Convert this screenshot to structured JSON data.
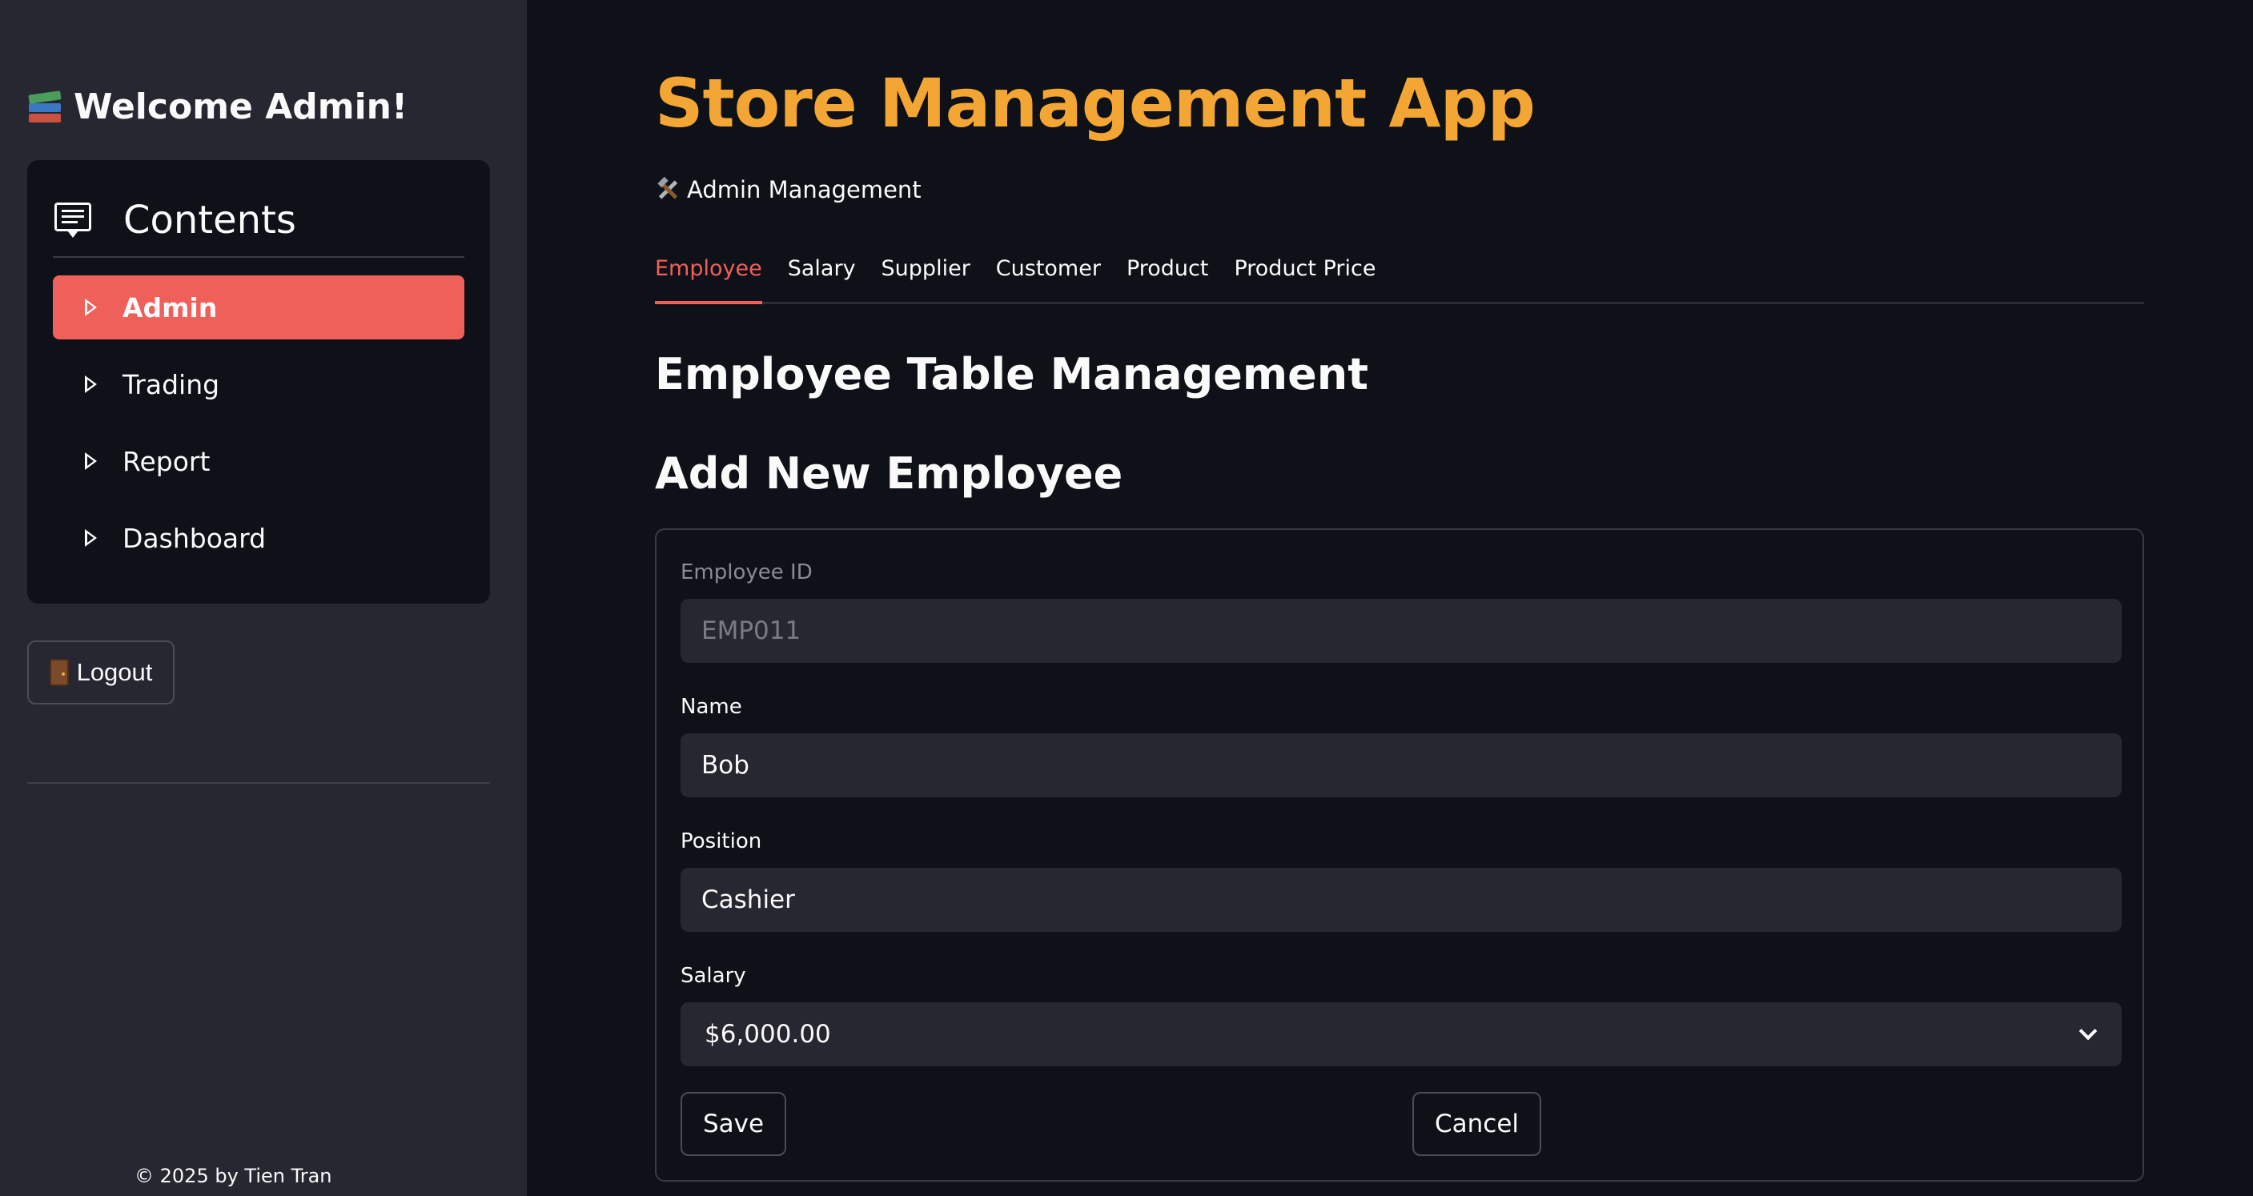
{
  "sidebar": {
    "welcome": "Welcome Admin!",
    "welcome_icon": "books-icon",
    "menu": {
      "title": "Contents",
      "title_icon": "contents-icon",
      "items": [
        {
          "label": "Admin",
          "active": true
        },
        {
          "label": "Trading",
          "active": false
        },
        {
          "label": "Report",
          "active": false
        },
        {
          "label": "Dashboard",
          "active": false
        }
      ]
    },
    "logout_label": "Logout",
    "logout_icon": "door-icon",
    "footer": "© 2025 by Tien Tran"
  },
  "header": {
    "title": "Store Management App",
    "subtitle": "Admin Management",
    "subtitle_icon": "tools-icon"
  },
  "tabs": [
    {
      "label": "Employee",
      "active": true
    },
    {
      "label": "Salary",
      "active": false
    },
    {
      "label": "Supplier",
      "active": false
    },
    {
      "label": "Customer",
      "active": false
    },
    {
      "label": "Product",
      "active": false
    },
    {
      "label": "Product Price",
      "active": false
    }
  ],
  "main": {
    "section_title": "Employee Table Management",
    "form_title": "Add New Employee",
    "form": {
      "employee_id": {
        "label": "Employee ID",
        "value": "EMP011",
        "disabled": true
      },
      "name": {
        "label": "Name",
        "value": "Bob"
      },
      "position": {
        "label": "Position",
        "value": "Cashier"
      },
      "salary": {
        "label": "Salary",
        "selected": "$6,000.00"
      },
      "save_label": "Save",
      "cancel_label": "Cancel"
    }
  },
  "colors": {
    "accent": "#f0605a",
    "title": "#f3a634",
    "background": "#0e1117",
    "sidebar": "#262730"
  }
}
